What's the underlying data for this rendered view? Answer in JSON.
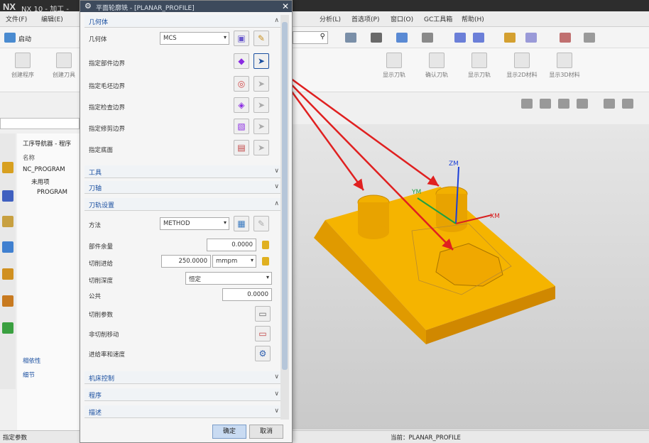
{
  "app": {
    "logo": "NX",
    "title": "NX 10 - 加工 -"
  },
  "menubar": {
    "items": [
      "文件(F)",
      "编辑(E)",
      "分析(L)",
      "首选项(P)",
      "窗口(O)",
      "GC工具箱",
      "帮助(H)"
    ]
  },
  "toolbar": {
    "start_label": "启动"
  },
  "ribbon": {
    "labels": [
      "创建程序",
      "创建刀具",
      "显示刀轨",
      "确认刀轨",
      "显示刀轨",
      "显示2D材料",
      "显示3D材料"
    ]
  },
  "navigator": {
    "title": "工序导航器 - 程序",
    "column_name": "名称",
    "tree": [
      "NC_PROGRAM",
      "未用项",
      "PROGRAM"
    ],
    "dependencies": "相依性",
    "details": "细节"
  },
  "dialog": {
    "title": "平面轮廓铣 - [PLANAR_PROFILE]",
    "sections": {
      "geometry": "几何体",
      "tool": "工具",
      "tool_axis": "刀轴",
      "toolpath_settings": "刀轨设置",
      "machine_control": "机床控制",
      "program": "程序",
      "description": "描述"
    },
    "geometry_label": "几何体",
    "geometry_value": "MCS",
    "boundaries": [
      "指定部件边界",
      "指定毛坯边界",
      "指定检查边界",
      "指定修剪边界",
      "指定底面"
    ],
    "method_label": "方法",
    "method_value": "METHOD",
    "part_stock_label": "部件余量",
    "part_stock_value": "0.0000",
    "feed_label": "切削进给",
    "feed_value": "250.0000",
    "feed_unit": "mmpm",
    "depth_label": "切削深度",
    "depth_value": "恒定",
    "tolerance_label": "公共",
    "tolerance_value": "0.0000",
    "cut_params": "切削参数",
    "noncut_moves": "非切削移动",
    "feeds_speeds": "进给率和速度",
    "ok": "确定",
    "cancel": "取消"
  },
  "viewport": {
    "axes": [
      "ZM",
      "YM",
      "XM"
    ],
    "part_color": "#f0a800"
  },
  "status": {
    "left": "指定参数",
    "center": "当前：PLANAR_PROFILE"
  }
}
